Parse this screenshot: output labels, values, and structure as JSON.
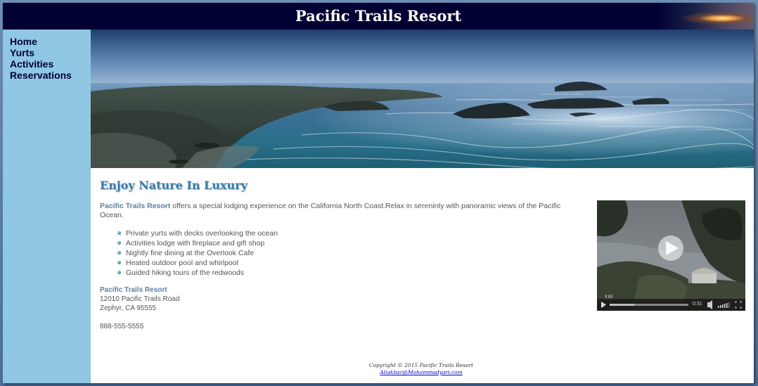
{
  "header": {
    "title": "Pacific Trails Resort"
  },
  "nav": {
    "items": [
      {
        "label": "Home"
      },
      {
        "label": "Yurts"
      },
      {
        "label": "Activities"
      },
      {
        "label": "Reservations"
      }
    ]
  },
  "main": {
    "heading": "Enjoy Nature In Luxury",
    "intro_brand": "Pacific Trails Resort",
    "intro_text": " offers a special lodging experience on the California North Coast.Relax in sereninty with panoramic views of the Pacific Ocean.",
    "features": [
      "Private yurts with decks overlooking the ocean",
      "Activities lodge with fireplace and gift shop",
      "Nightly fine dining at the Overlook Cafe",
      "Heated outdoor pool and whirlpool",
      "Guided hiking tours of the redwoods"
    ],
    "contact": {
      "name": "Pacific Trails Resort",
      "street": "12010 Pacific Trails Road",
      "city": "Zephyr, CA 95555",
      "phone": "888-555-5555"
    }
  },
  "video": {
    "current_time": "0:00",
    "duration": "0:31",
    "progress": 0.0,
    "volume_level": 0.8
  },
  "footer": {
    "copyright": "Copyright © 2015 Pacific Trails Resort",
    "email": "Aliakbar@Mohammadyari.com"
  },
  "colors": {
    "header_bg": "#000033",
    "nav_bg": "#90c7e3",
    "heading": "#3f7ba6",
    "brand_text": "#5c7fa3",
    "link": "#0000cc"
  },
  "icons": {
    "play": "play-icon",
    "volume": "volume-icon",
    "fullscreen": "fullscreen-icon",
    "bullet": "bullet-icon"
  }
}
